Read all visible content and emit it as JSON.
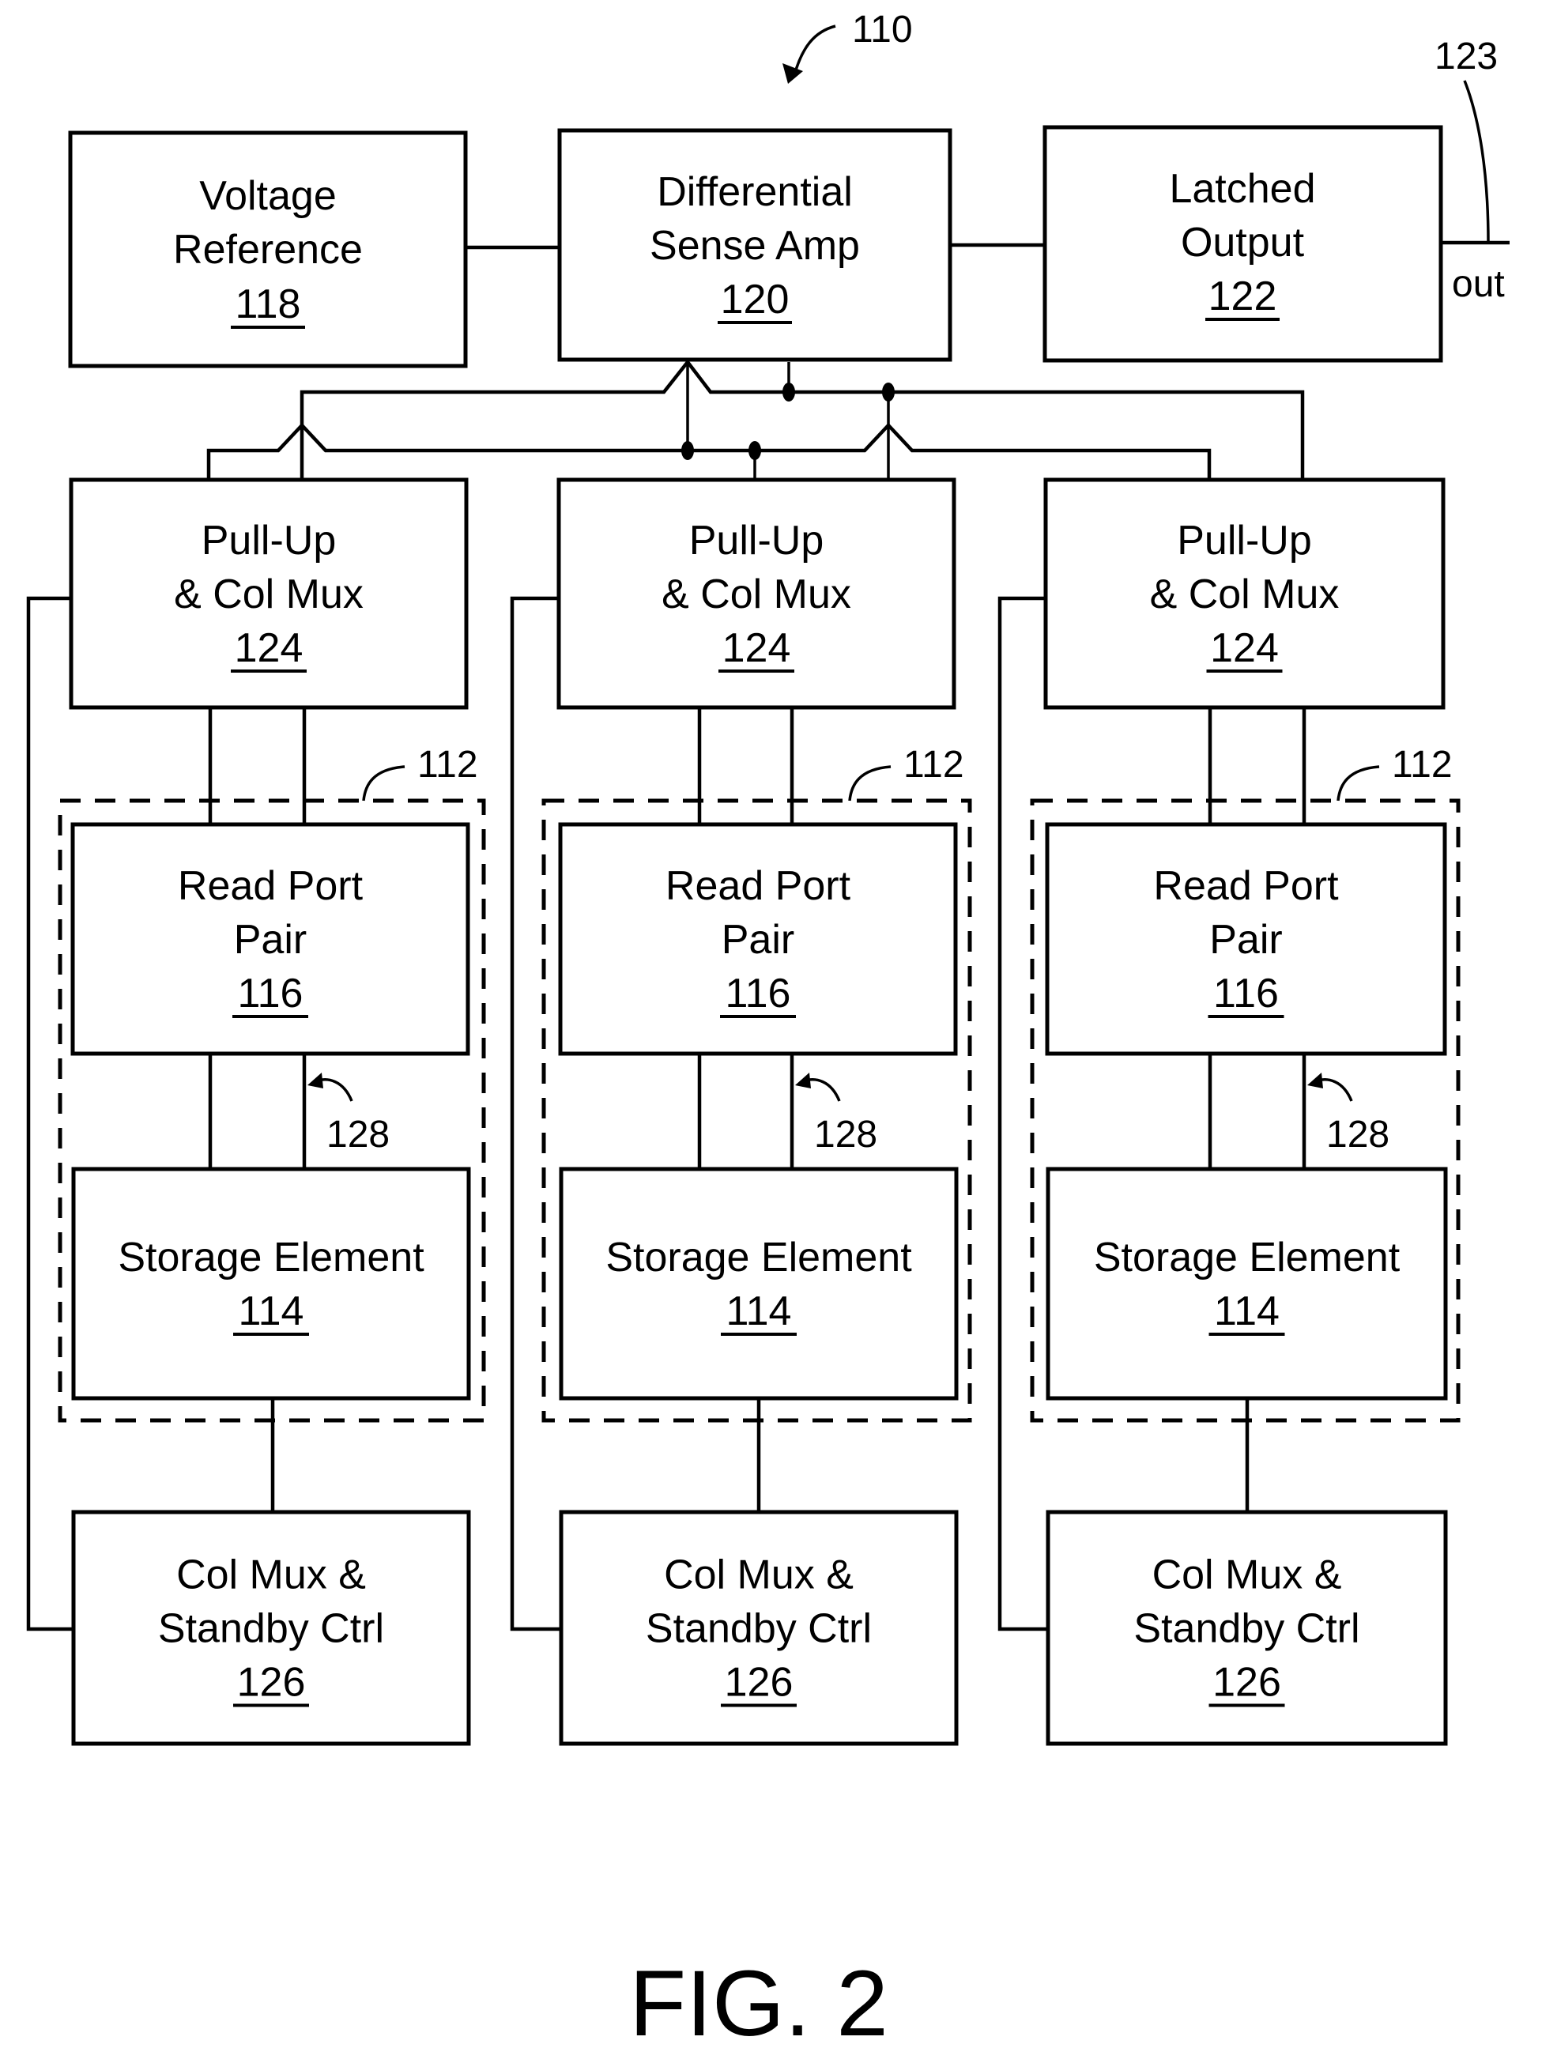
{
  "figure": {
    "caption": "FIG. 2",
    "reference": "110"
  },
  "top_row": {
    "voltage_reference": {
      "lines": [
        "Voltage",
        "Reference"
      ],
      "ref": "118"
    },
    "differential_sense_amp": {
      "lines": [
        "Differential",
        "Sense Amp"
      ],
      "ref": "120"
    },
    "latched_output": {
      "lines": [
        "Latched",
        "Output"
      ],
      "ref": "122"
    },
    "output_signal": {
      "label": "out",
      "ref": "123"
    }
  },
  "columns": [
    {
      "bitcell_ref": "112",
      "pull_up": {
        "lines": [
          "Pull-Up",
          "& Col Mux"
        ],
        "ref": "124"
      },
      "read_port": {
        "lines": [
          "Read Port",
          "Pair"
        ],
        "ref": "116"
      },
      "storage": {
        "lines": [
          "Storage Element"
        ],
        "ref": "114"
      },
      "node_ref": "128",
      "standby": {
        "lines": [
          "Col Mux &",
          "Standby Ctrl"
        ],
        "ref": "126"
      }
    },
    {
      "bitcell_ref": "112",
      "pull_up": {
        "lines": [
          "Pull-Up",
          "& Col Mux"
        ],
        "ref": "124"
      },
      "read_port": {
        "lines": [
          "Read Port",
          "Pair"
        ],
        "ref": "116"
      },
      "storage": {
        "lines": [
          "Storage Element"
        ],
        "ref": "114"
      },
      "node_ref": "128",
      "standby": {
        "lines": [
          "Col Mux &",
          "Standby Ctrl"
        ],
        "ref": "126"
      }
    },
    {
      "bitcell_ref": "112",
      "pull_up": {
        "lines": [
          "Pull-Up",
          "& Col Mux"
        ],
        "ref": "124"
      },
      "read_port": {
        "lines": [
          "Read Port",
          "Pair"
        ],
        "ref": "116"
      },
      "storage": {
        "lines": [
          "Storage Element"
        ],
        "ref": "114"
      },
      "node_ref": "128",
      "standby": {
        "lines": [
          "Col Mux &",
          "Standby Ctrl"
        ],
        "ref": "126"
      }
    }
  ]
}
